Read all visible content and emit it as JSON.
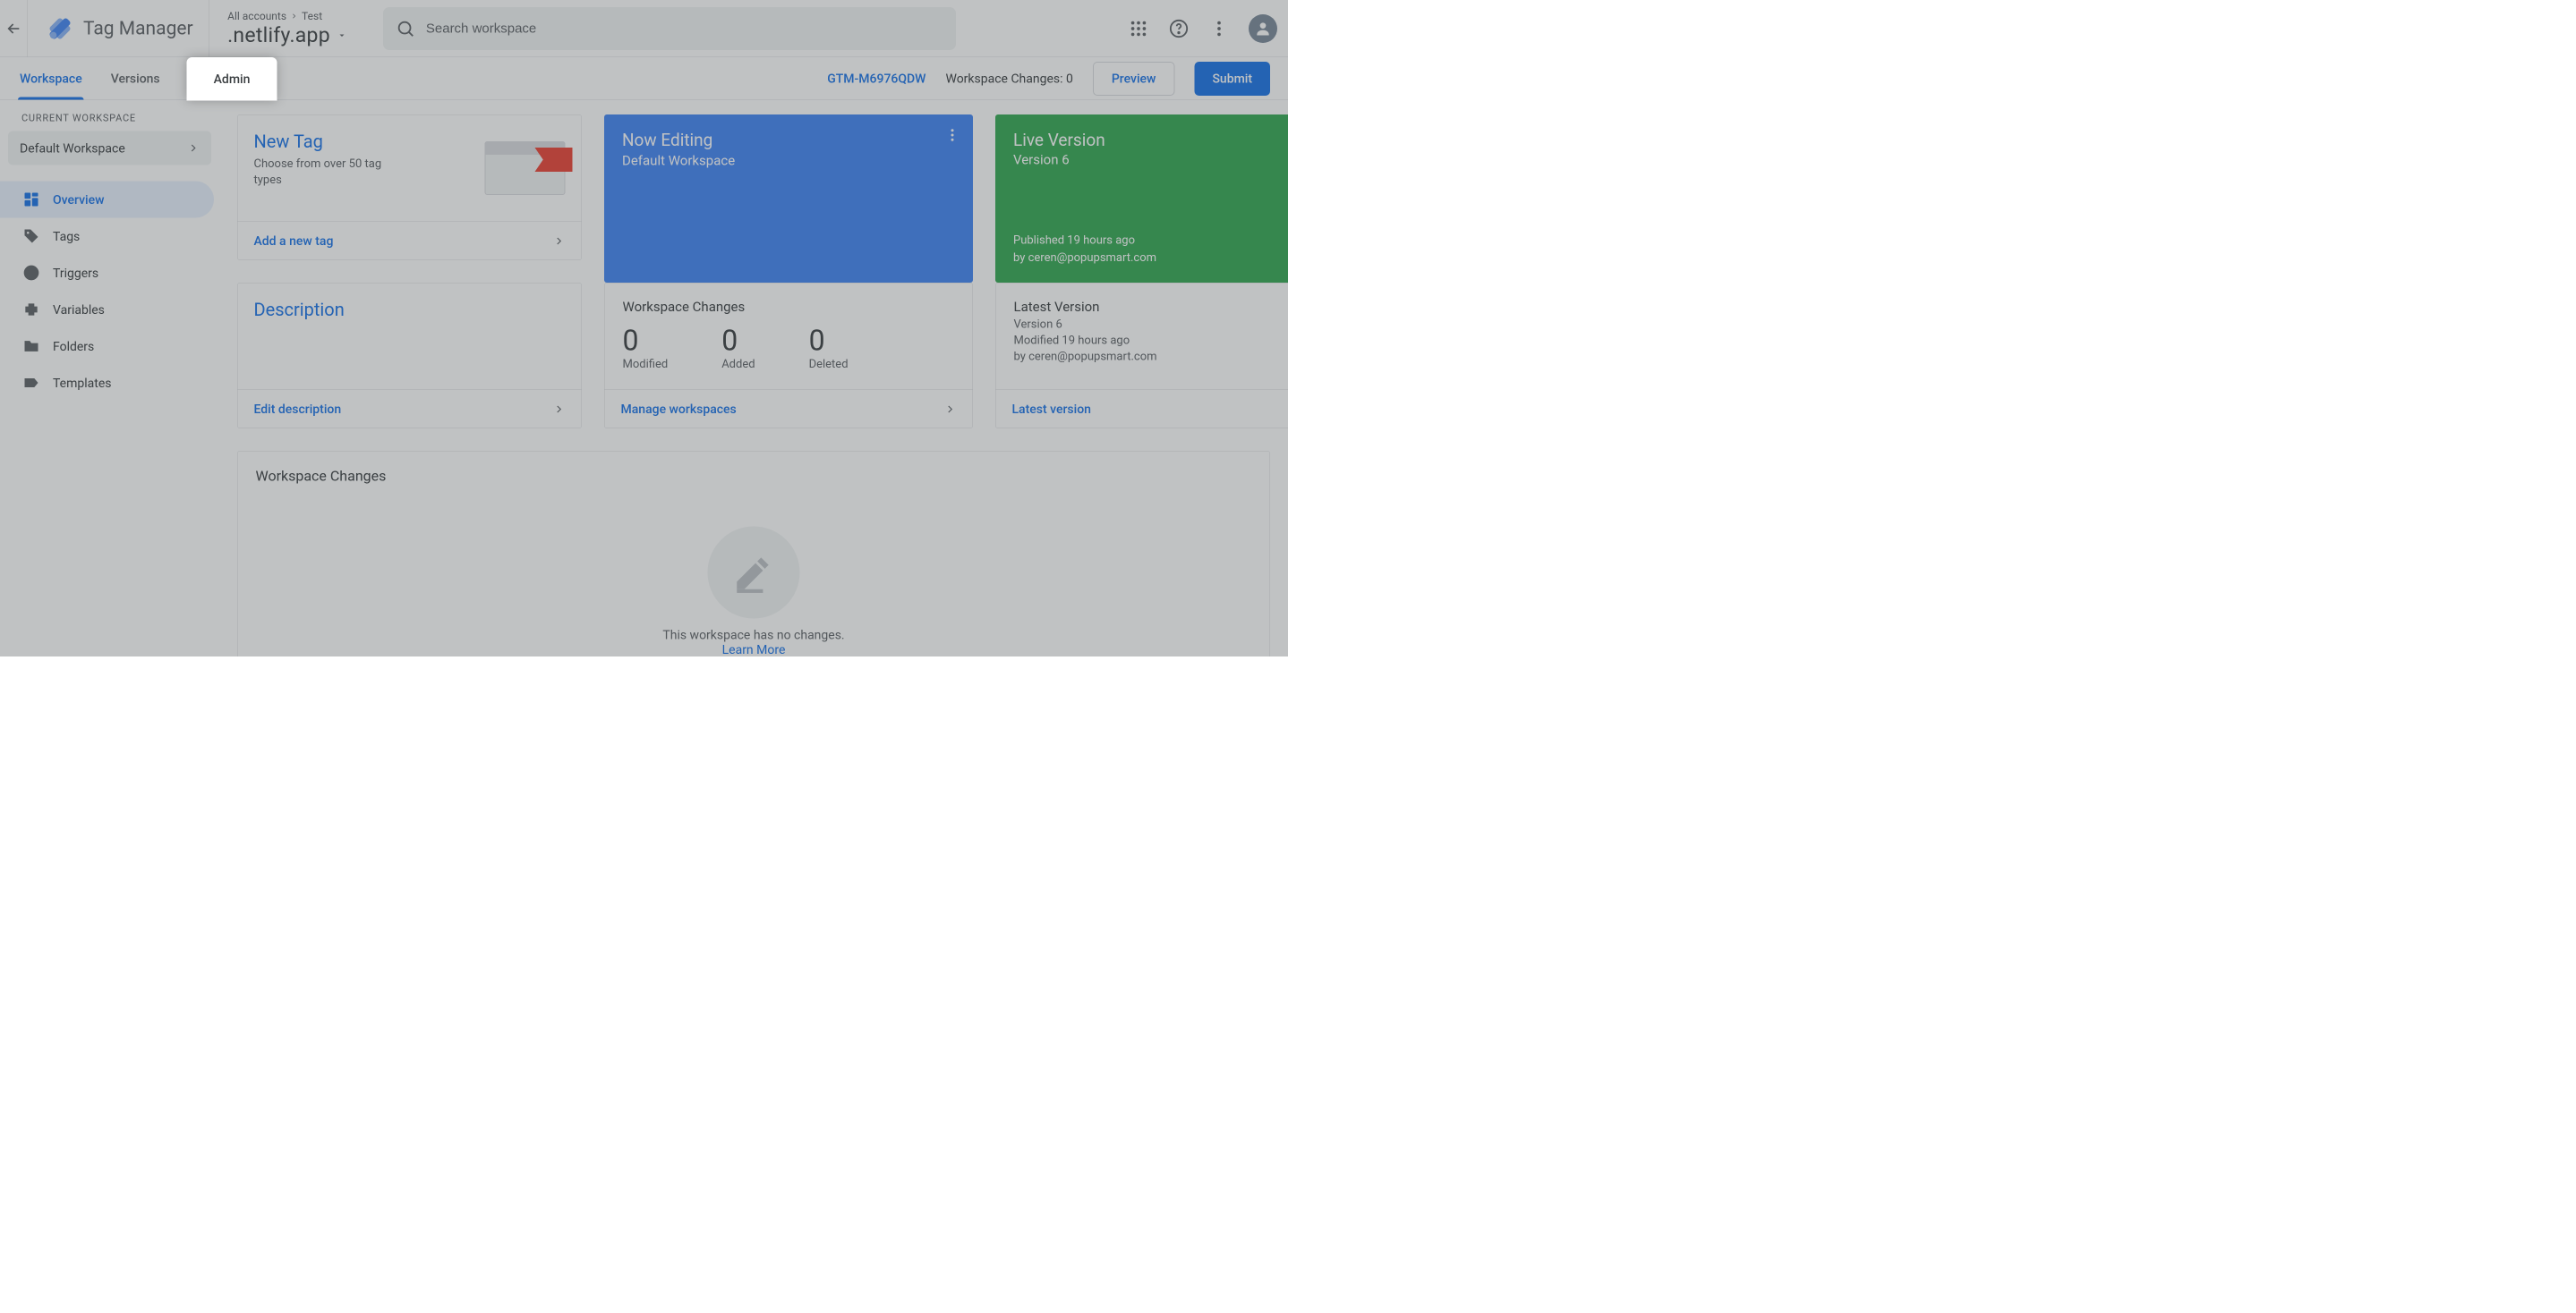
{
  "header": {
    "product_name": "Tag Manager",
    "breadcrumb_root": "All accounts",
    "breadcrumb_account": "Test",
    "container_name": ".netlify.app",
    "search_placeholder": "Search workspace"
  },
  "subnav": {
    "tabs": [
      "Workspace",
      "Versions",
      "Admin"
    ],
    "active_tab_index": 0,
    "elevated_tab_index": 2,
    "gtm_id": "GTM-M6976QDW",
    "workspace_changes_label": "Workspace Changes:",
    "workspace_changes_count": "0",
    "preview_label": "Preview",
    "submit_label": "Submit"
  },
  "sidebar": {
    "section_label": "CURRENT WORKSPACE",
    "workspace_name": "Default Workspace",
    "items": [
      {
        "label": "Overview",
        "icon": "dashboard-icon",
        "active": true
      },
      {
        "label": "Tags",
        "icon": "tag-icon"
      },
      {
        "label": "Triggers",
        "icon": "target-icon"
      },
      {
        "label": "Variables",
        "icon": "puzzle-icon"
      },
      {
        "label": "Folders",
        "icon": "folder-icon"
      },
      {
        "label": "Templates",
        "icon": "label-icon"
      }
    ]
  },
  "cards": {
    "new_tag": {
      "title": "New Tag",
      "subtitle": "Choose from over 50 tag types",
      "link": "Add a new tag"
    },
    "now_editing": {
      "title": "Now Editing",
      "subtitle": "Default Workspace"
    },
    "live_version": {
      "title": "Live Version",
      "version_line": "Version 6",
      "published_line": "Published 19 hours ago",
      "by_line": "by ceren@popupsmart.com"
    },
    "description": {
      "title": "Description",
      "link": "Edit description"
    },
    "workspace_changes": {
      "title": "Workspace Changes",
      "modified_n": "0",
      "modified_l": "Modified",
      "added_n": "0",
      "added_l": "Added",
      "deleted_n": "0",
      "deleted_l": "Deleted",
      "link": "Manage workspaces"
    },
    "latest_version": {
      "title": "Latest Version",
      "version_line": "Version 6",
      "modified_line": "Modified 19 hours ago",
      "by_line": "by ceren@popupsmart.com",
      "link": "Latest version"
    },
    "changes_panel": {
      "title": "Workspace Changes",
      "empty_msg": "This workspace has no changes.",
      "learn_more": "Learn More"
    }
  },
  "colors": {
    "blue": "#4285f4",
    "green": "#34a853",
    "red": "#ea4335",
    "link": "#1a73e8"
  }
}
